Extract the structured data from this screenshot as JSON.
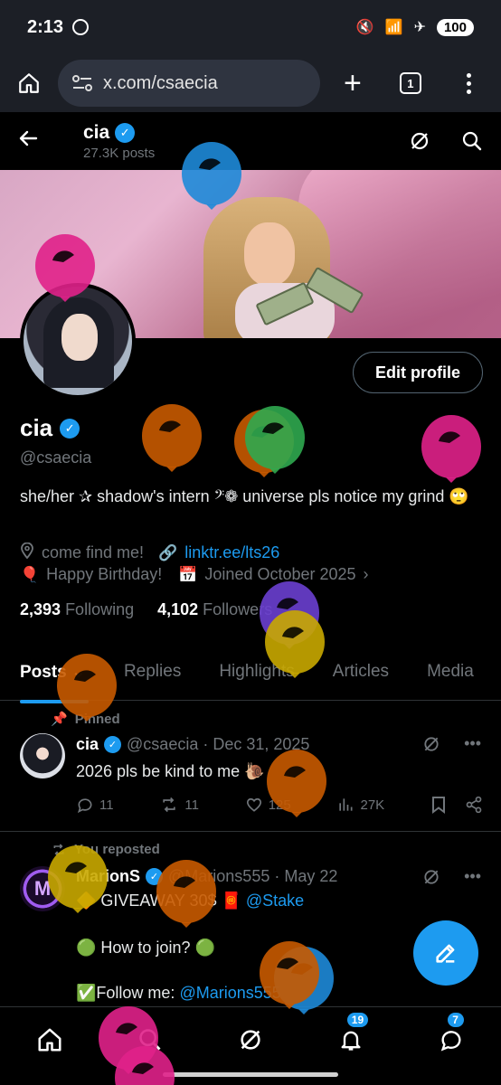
{
  "status_bar": {
    "time": "2:13",
    "battery": "100"
  },
  "browser": {
    "url": "x.com/csaecia",
    "tab_count": "1"
  },
  "profile_header": {
    "name": "cia",
    "posts_count": "27.3K posts"
  },
  "profile": {
    "edit_button": "Edit profile",
    "name": "cia",
    "handle": "@csaecia",
    "bio": "she/her ✰ shadow's intern 𝄢❁ universe pls notice my grind 🙄",
    "location": "come find me!",
    "link": "linktr.ee/lts26",
    "birthday": "Happy Birthday!",
    "joined": "Joined October 2025",
    "following_count": "2,393",
    "following_label": "Following",
    "followers_count": "4,102",
    "followers_label": "Followers"
  },
  "tabs": [
    "Posts",
    "Replies",
    "Highlights",
    "Articles",
    "Media"
  ],
  "posts": [
    {
      "context": "Pinned",
      "name": "cia",
      "handle_date": "@csaecia · Dec 31, 2025",
      "text": "2026 pls be kind to me 🐌",
      "replies": "11",
      "reposts": "11",
      "likes": "125",
      "views": "27K"
    },
    {
      "context": "You reposted",
      "name": "MarionS",
      "handle_date": "@Marions555 · May 22",
      "line1_prefix": "🔶 GIVEAWAY 30$ 🧧 ",
      "line1_link": "@Stake",
      "line2": "🟢 How to join? 🟢",
      "line3_prefix": "✅Follow me: ",
      "line3_link": "@Marions555"
    }
  ],
  "bottom_nav": {
    "notifications_badge": "19",
    "messages_badge": "7"
  },
  "colors": {
    "accent": "#1d9bf0",
    "background": "#000000",
    "muted": "#71767b"
  },
  "balloon_colors": [
    "#1e8ad8",
    "#e0218a",
    "#c85a00",
    "#2fa84f",
    "#6a3fd0",
    "#c9a800"
  ]
}
